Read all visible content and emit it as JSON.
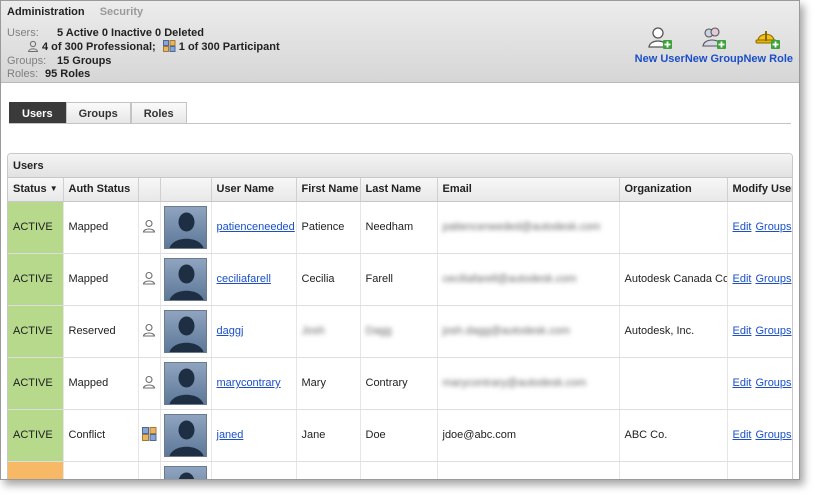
{
  "breadcrumb": {
    "admin": "Administration",
    "security": "Security"
  },
  "stats": {
    "users_label": "Users:",
    "users_value": "5 Active  0 Inactive  0 Deleted",
    "professional": "4 of 300 Professional;",
    "participant": "1 of 300 Participant",
    "groups_label": "Groups:",
    "groups_value": "15 Groups",
    "roles_label": "Roles:",
    "roles_value": "95 Roles"
  },
  "actions": [
    {
      "label": "New User",
      "icon": "user-add-icon"
    },
    {
      "label": "New Group",
      "icon": "group-add-icon"
    },
    {
      "label": "New Role",
      "icon": "role-add-icon"
    }
  ],
  "tabs": [
    {
      "label": "Users",
      "selected": true
    },
    {
      "label": "Groups",
      "selected": false
    },
    {
      "label": "Roles",
      "selected": false
    }
  ],
  "panel": {
    "title": "Users"
  },
  "table": {
    "headers": {
      "status": "Status",
      "auth": "Auth Status",
      "username": "User Name",
      "first": "First Name",
      "last": "Last Name",
      "email": "Email",
      "org": "Organization",
      "modify": "Modify User"
    },
    "sort_arrow": "▼",
    "rows": [
      {
        "status": "ACTIVE",
        "auth": "Mapped",
        "type": "professional",
        "username": "patienceneeded",
        "first": "Patience",
        "last": "Needham",
        "email": "patienceneeded@autodesk.com",
        "org": "",
        "edit": "Edit",
        "groups": "Groups",
        "blur": {
          "email": true,
          "first": false,
          "last": false
        }
      },
      {
        "status": "ACTIVE",
        "auth": "Mapped",
        "type": "professional",
        "username": "ceciliafarell",
        "first": "Cecilia",
        "last": "Farell",
        "email": "ceciliafarell@autodesk.com",
        "org": "Autodesk Canada Co.",
        "edit": "Edit",
        "groups": "Groups",
        "blur": {
          "email": true,
          "first": false,
          "last": false
        }
      },
      {
        "status": "ACTIVE",
        "auth": "Reserved",
        "type": "professional",
        "username": "daggj",
        "first": "Josh",
        "last": "Dagg",
        "email": "josh.dagg@autodesk.com",
        "org": "Autodesk, Inc.",
        "edit": "Edit",
        "groups": "Groups",
        "blur": {
          "email": true,
          "first": true,
          "last": true
        }
      },
      {
        "status": "ACTIVE",
        "auth": "Mapped",
        "type": "professional",
        "username": "marycontrary",
        "first": "Mary",
        "last": "Contrary",
        "email": "marycontrary@autodesk.com",
        "org": "",
        "edit": "Edit",
        "groups": "Groups",
        "blur": {
          "email": true,
          "first": false,
          "last": false
        }
      },
      {
        "status": "ACTIVE",
        "auth": "Conflict",
        "type": "participant",
        "username": "janed",
        "first": "Jane",
        "last": "Doe",
        "email": "jdoe@abc.com",
        "org": "ABC Co.",
        "edit": "Edit",
        "groups": "Groups",
        "blur": {
          "email": false,
          "first": false,
          "last": false
        }
      },
      {
        "status": "",
        "auth": "",
        "type": "",
        "username": "",
        "first": "",
        "last": "",
        "email": "",
        "org": "",
        "edit": "",
        "groups": "",
        "pending": true,
        "blur": {
          "email": false,
          "first": false,
          "last": false
        }
      }
    ]
  },
  "colors": {
    "active_status": "#b7d98c",
    "pending_status": "#f8b966",
    "link": "#1a4fc9",
    "selected_tab": "#3a3a3a"
  }
}
